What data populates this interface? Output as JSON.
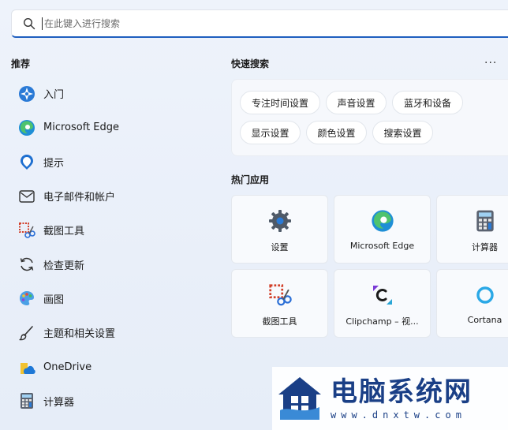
{
  "search": {
    "placeholder": "在此键入进行搜索"
  },
  "recommended": {
    "title": "推荐",
    "items": [
      {
        "label": "入门",
        "icon": "get-started-icon"
      },
      {
        "label": "Microsoft Edge",
        "icon": "edge-icon"
      },
      {
        "label": "提示",
        "icon": "tips-icon"
      },
      {
        "label": "电子邮件和帐户",
        "icon": "mail-icon"
      },
      {
        "label": "截图工具",
        "icon": "snipping-tool-icon"
      },
      {
        "label": "检查更新",
        "icon": "refresh-icon"
      },
      {
        "label": "画图",
        "icon": "paint-icon"
      },
      {
        "label": "主题和相关设置",
        "icon": "brush-icon"
      },
      {
        "label": "OneDrive",
        "icon": "onedrive-icon"
      },
      {
        "label": "计算器",
        "icon": "calculator-icon"
      }
    ]
  },
  "quick_search": {
    "title": "快速搜索",
    "more": "···",
    "chips": [
      "专注时间设置",
      "声音设置",
      "蓝牙和设备",
      "显示设置",
      "颜色设置",
      "搜索设置"
    ]
  },
  "top_apps": {
    "title": "热门应用",
    "tiles": [
      {
        "label": "设置",
        "icon": "gear-icon"
      },
      {
        "label": "Microsoft Edge",
        "icon": "edge-icon"
      },
      {
        "label": "计算器",
        "icon": "calculator-icon"
      },
      {
        "label": "截图工具",
        "icon": "snipping-tool-icon"
      },
      {
        "label": "Clipchamp – 视...",
        "icon": "clipchamp-icon"
      },
      {
        "label": "Cortana",
        "icon": "cortana-icon"
      }
    ]
  },
  "watermark": {
    "title": "电脑系统网",
    "url": "www.dnxtw.com"
  },
  "colors": {
    "accent": "#1f5fbf",
    "brand_watermark": "#1a3f86"
  }
}
